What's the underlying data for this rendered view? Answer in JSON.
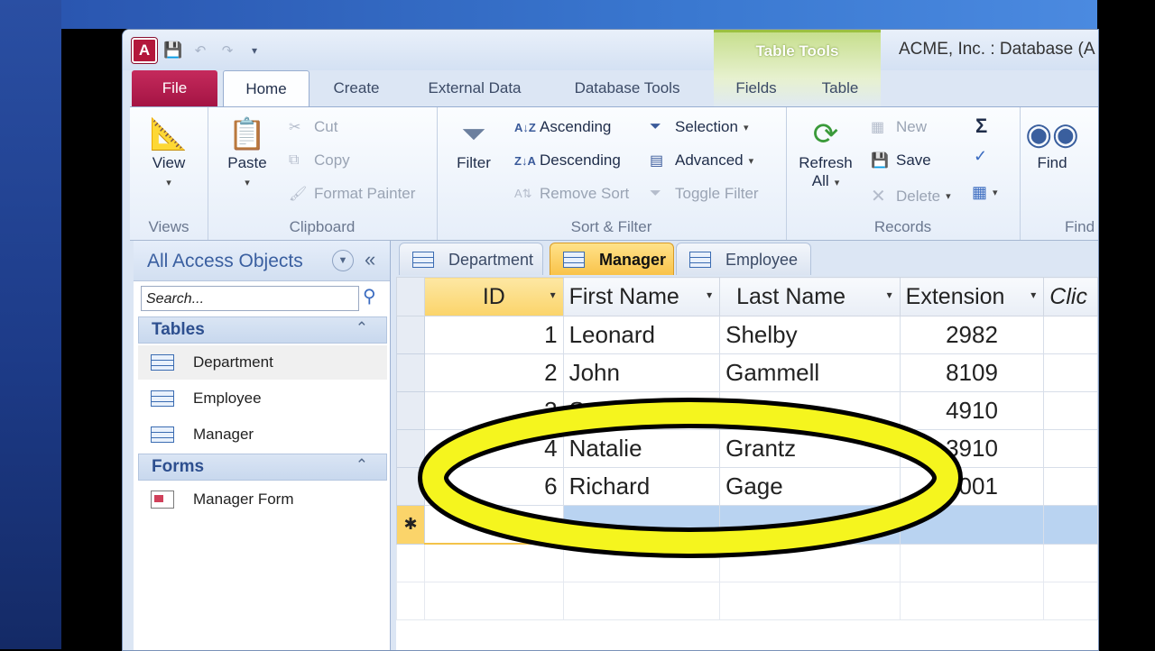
{
  "window": {
    "title": "ACME, Inc. : Database (A",
    "context_tab_group": "Table Tools"
  },
  "ribbon_tabs": [
    "File",
    "Home",
    "Create",
    "External Data",
    "Database Tools",
    "Fields",
    "Table"
  ],
  "ribbon": {
    "views": {
      "view_label": "View",
      "group_label": "Views"
    },
    "clipboard": {
      "paste_label": "Paste",
      "cut_label": "Cut",
      "copy_label": "Copy",
      "format_painter_label": "Format Painter",
      "group_label": "Clipboard"
    },
    "sort_filter": {
      "filter_label": "Filter",
      "ascending_label": "Ascending",
      "descending_label": "Descending",
      "remove_sort_label": "Remove Sort",
      "selection_label": "Selection",
      "advanced_label": "Advanced",
      "toggle_filter_label": "Toggle Filter",
      "group_label": "Sort & Filter"
    },
    "records": {
      "refresh_label_1": "Refresh",
      "refresh_label_2": "All",
      "new_label": "New",
      "save_label": "Save",
      "delete_label": "Delete",
      "totals_symbol": "Σ",
      "group_label": "Records"
    },
    "find": {
      "find_label": "Find",
      "group_label": "Find"
    }
  },
  "nav_pane": {
    "title": "All Access Objects",
    "search_placeholder": "Search...",
    "sections": [
      {
        "label": "Tables",
        "items": [
          "Department",
          "Employee",
          "Manager"
        ]
      },
      {
        "label": "Forms",
        "items": [
          "Manager Form"
        ]
      }
    ]
  },
  "document_tabs": [
    {
      "label": "Department",
      "active": false
    },
    {
      "label": "Manager",
      "active": true
    },
    {
      "label": "Employee",
      "active": false
    }
  ],
  "datasheet": {
    "columns": [
      "ID",
      "First Name",
      "Last Name",
      "Extension",
      "Clic"
    ],
    "rows": [
      {
        "id": "1",
        "first": "Leonard",
        "last": "Shelby",
        "ext": "2982"
      },
      {
        "id": "2",
        "first": "John",
        "last": "Gammell",
        "ext": "8109"
      },
      {
        "id": "3",
        "first": "S",
        "last": "bi",
        "ext": "4910"
      },
      {
        "id": "4",
        "first": "Natalie",
        "last": "Grantz",
        "ext": "3910"
      },
      {
        "id": "6",
        "first": "Richard",
        "last": "Gage",
        "ext": "2001"
      }
    ],
    "new_record_marker": "✱"
  },
  "colors": {
    "file_tab": "#b5194d",
    "active_tab": "#f9c34a",
    "annotation_ring": "#f5f51e",
    "new_row": "#b9d3f1"
  }
}
